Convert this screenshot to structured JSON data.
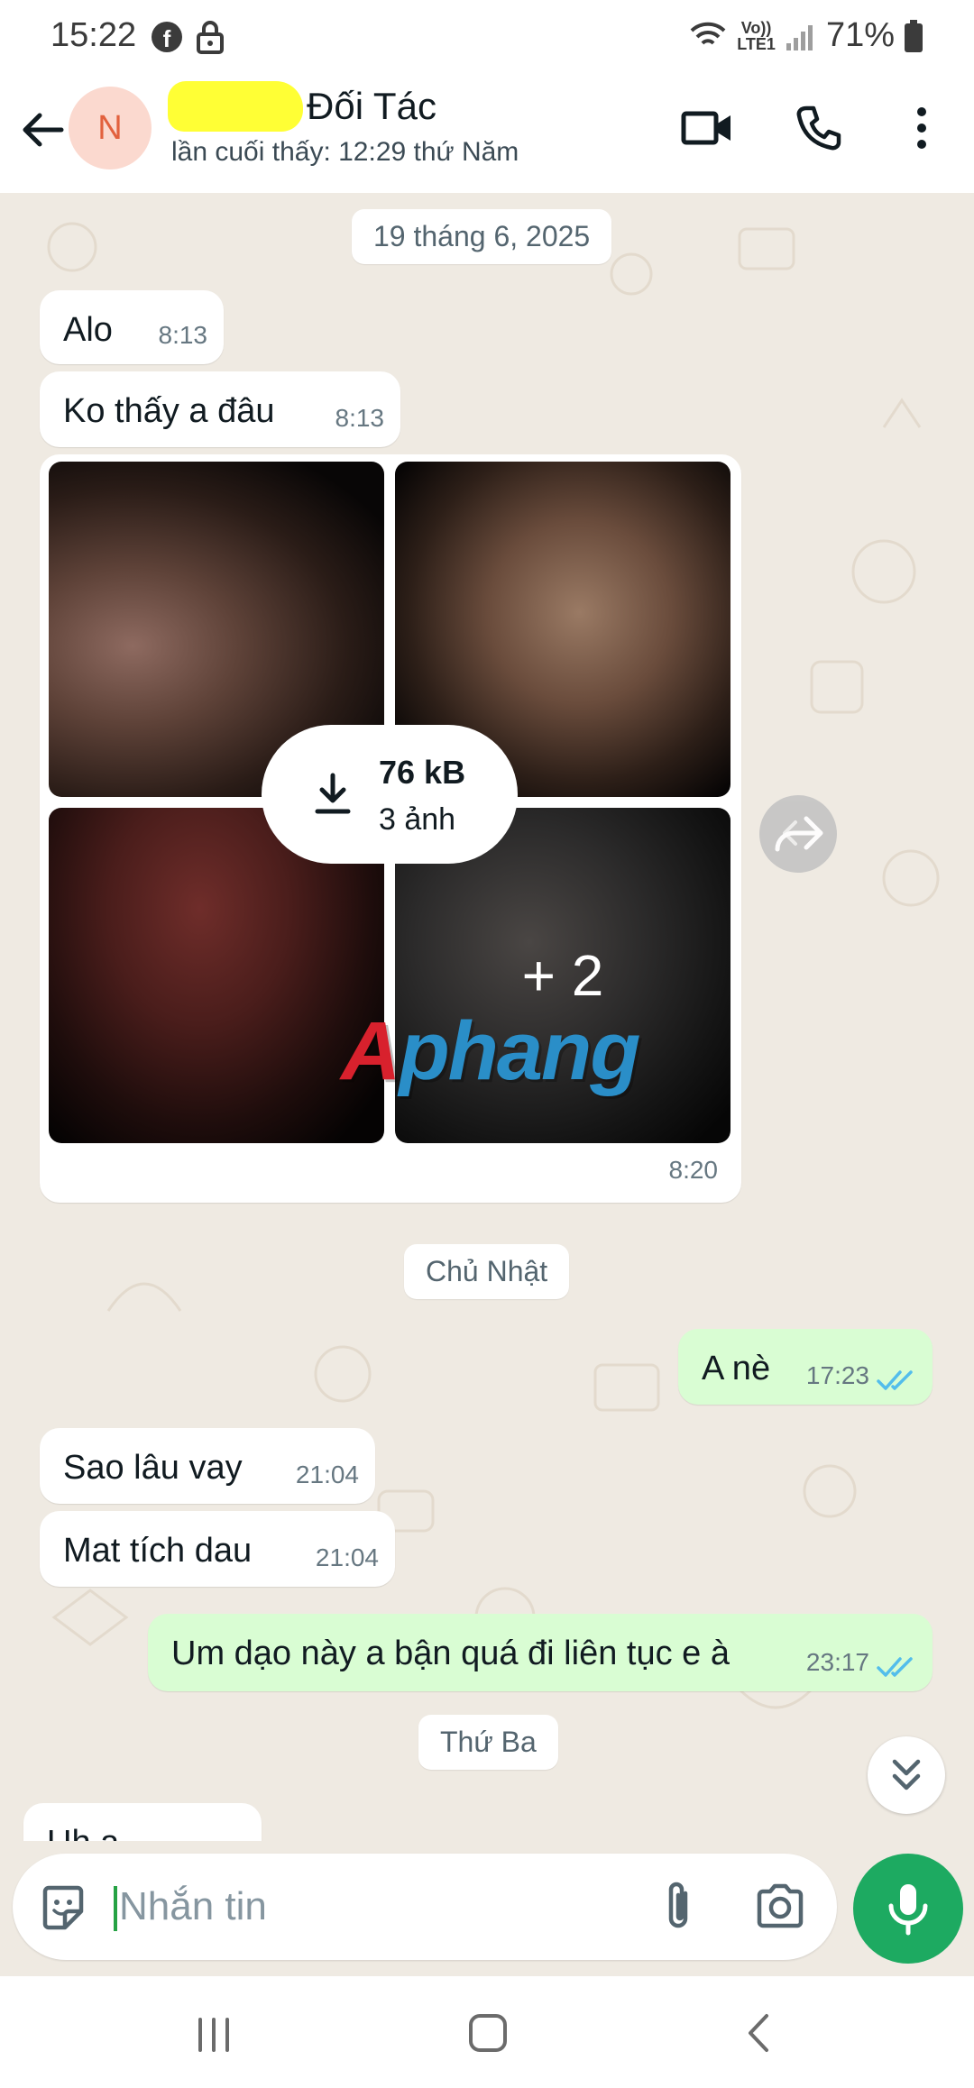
{
  "status_bar": {
    "time": "15:22",
    "network_top": "Vo))",
    "network_bottom": "LTE1",
    "battery": "71%"
  },
  "header": {
    "avatar_initial": "N",
    "contact_name": "Đối Tác",
    "last_seen": "lần cuối thấy: 12:29 thứ Năm"
  },
  "chat": {
    "date_chip_1": "19 tháng 6, 2025",
    "msg_alo": {
      "text": "Alo",
      "time": "8:13"
    },
    "msg_ko_thay": {
      "text": "Ko thấy a đâu",
      "time": "8:13"
    },
    "media_group": {
      "size": "76 kB",
      "count": "3 ảnh",
      "more": "+ 2",
      "time": "8:20"
    },
    "watermark": {
      "first": "A",
      "rest": "phang"
    },
    "date_chip_2": "Chủ Nhật",
    "msg_a_ne": {
      "text": "A nè",
      "time": "17:23"
    },
    "msg_sao_lau": {
      "text": "Sao lâu vay",
      "time": "21:04"
    },
    "msg_mat_tich": {
      "text": "Mat tích dau",
      "time": "21:04"
    },
    "msg_um_dao": {
      "text": "Um dạo này a bận quá đi liên tục e à",
      "time": "23:17"
    },
    "date_chip_3": "Thứ Ba",
    "msg_partial": {
      "text": "Uh a"
    }
  },
  "input": {
    "placeholder": "Nhắn tin"
  },
  "colors": {
    "accent": "#1daa61",
    "read_tick": "#53bdeb",
    "outgoing_bubble": "#d9fdd3",
    "chat_bg": "#efeae2"
  },
  "icons": [
    "back-arrow-icon",
    "video-call-icon",
    "voice-call-icon",
    "more-menu-icon",
    "download-icon",
    "forward-icon",
    "double-check-icon",
    "chevrons-down-icon",
    "sticker-icon",
    "attach-icon",
    "camera-icon",
    "mic-icon"
  ]
}
